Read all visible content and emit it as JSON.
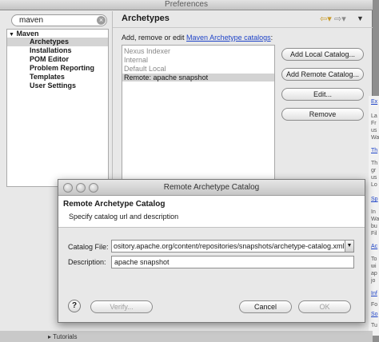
{
  "preferences": {
    "title": "Preferences",
    "filter": {
      "value": "maven",
      "clear_icon": "clear-icon"
    },
    "tree": {
      "root": "Maven",
      "items": [
        "Archetypes",
        "Installations",
        "POM Editor",
        "Problem Reporting",
        "Templates",
        "User Settings"
      ],
      "selected": "Archetypes"
    },
    "page_heading": "Archetypes",
    "description_prefix": "Add, remove or edit ",
    "description_link": "Maven Archetype catalogs",
    "description_suffix": ":",
    "catalogs": [
      "Nexus Indexer",
      "Internal",
      "Default Local",
      "Remote: apache snapshot"
    ],
    "selected_catalog": "Remote: apache snapshot",
    "buttons": {
      "add_local": "Add Local Catalog...",
      "add_remote": "Add Remote Catalog...",
      "edit": "Edit...",
      "remove": "Remove"
    },
    "help_panel": {
      "links": [
        "Ex",
        "Th",
        "Sp",
        "Ac",
        "Inf",
        "So"
      ],
      "snippets": [
        "La",
        "Fr",
        "us",
        "Wa",
        "Th",
        "gr",
        "us",
        "Lo",
        "In",
        "Wa",
        "bu",
        "Fil",
        "To",
        "wi",
        "ap",
        "jo",
        "Fo",
        "Tu"
      ]
    },
    "bottom_item": "Tutorials"
  },
  "dialog": {
    "title": "Remote Archetype Catalog",
    "heading": "Remote Archetype Catalog",
    "subheading": "Specify catalog url and description",
    "catalog_file_label": "Catalog File:",
    "catalog_file_value": "ository.apache.org/content/repositories/snapshots/archetype-catalog.xml",
    "description_label": "Description:",
    "description_value": "apache snapshot",
    "help_label": "?",
    "verify_label": "Verify...",
    "cancel_label": "Cancel",
    "ok_label": "OK"
  },
  "colors": {
    "link": "#1f44c8",
    "selection": "#d3d3d3",
    "disabled_text": "#a0a0a0"
  }
}
